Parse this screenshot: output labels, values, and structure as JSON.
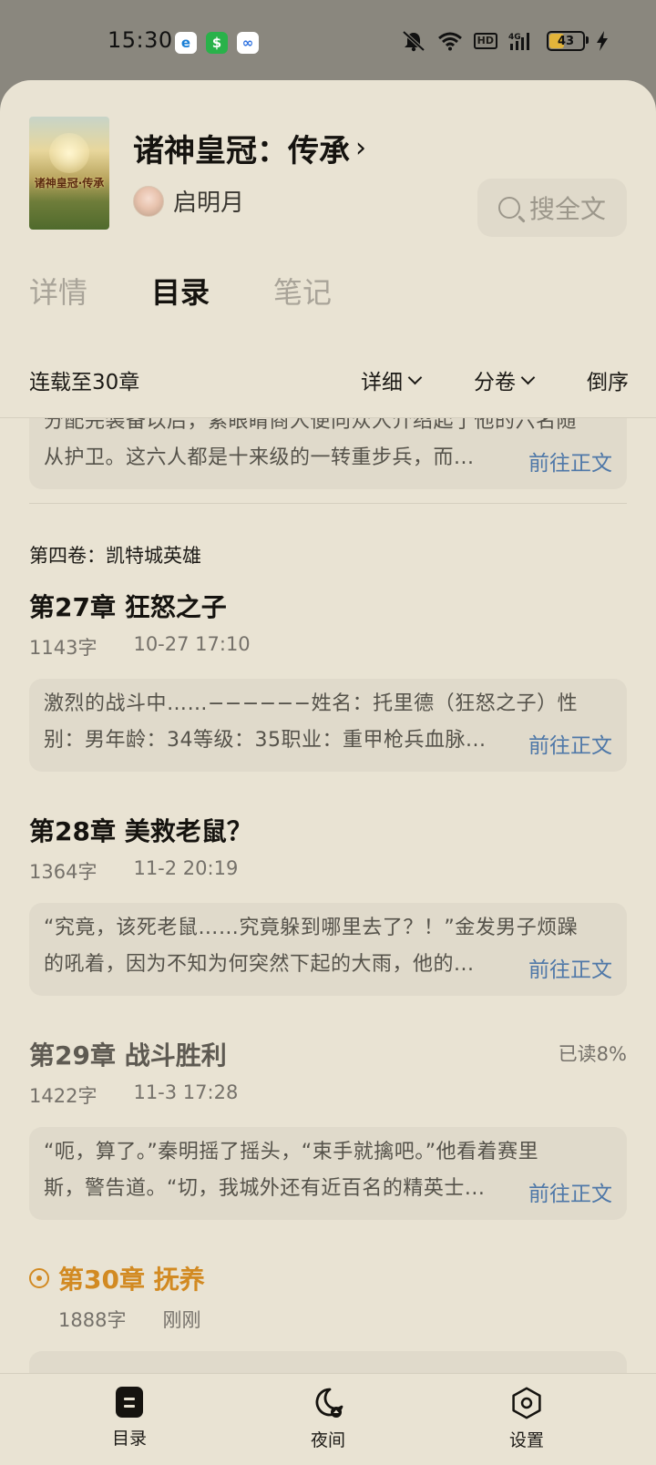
{
  "status_bar": {
    "time": "15:30",
    "battery": "43",
    "battery_fraction": 0.43,
    "app_icons": [
      "telecom-icon",
      "wallet-icon",
      "cloud-icon"
    ]
  },
  "book": {
    "title": "诸神皇冠：传承",
    "author": "启明月",
    "cover_text": "诸神皇冠·传承"
  },
  "search": {
    "label": "搜全文"
  },
  "tabs": [
    {
      "label": "详情",
      "active": false
    },
    {
      "label": "目录",
      "active": true
    },
    {
      "label": "笔记",
      "active": false
    }
  ],
  "filters": {
    "status": "连载至30章",
    "detail": "详细",
    "volume": "分卷",
    "order": "倒序"
  },
  "goto_label": "前往正文",
  "top_summary": {
    "line1": "分配完装备以后，紫眼睛商人便向众人介绍起了他的六名随",
    "line2": "从护卫。这六人都是十来级的一转重步兵，而..."
  },
  "volume_title": "第四卷：凯特城英雄",
  "chapters": [
    {
      "title": "第27章 狂怒之子",
      "words": "1143字",
      "time": "10-27 17:10",
      "line1": "激烈的战斗中……−−−−−−姓名：托里德（狂怒之子）性",
      "line2": "别：男年龄：34等级：35职业：重甲枪兵血脉..."
    },
    {
      "title": "第28章 美救老鼠？",
      "words": "1364字",
      "time": "11-2 20:19",
      "line1": "“究竟，该死老鼠……究竟躲到哪里去了？！”金发男子烦躁",
      "line2": "的吼着，因为不知为何突然下起的大雨，他的..."
    },
    {
      "title": "第29章 战斗胜利",
      "words": "1422字",
      "time": "11-3 17:28",
      "progress": "已读8%",
      "line1": "“呃，算了。”秦明摇了摇头，“束手就擒吧。”他看着赛里",
      "line2": "斯，警告道。“切，我城外还有近百名的精英士..."
    },
    {
      "title": "第30章 抚养",
      "words": "1888字",
      "time": "刚刚"
    }
  ],
  "nav": {
    "toc": "目录",
    "night": "夜间",
    "settings": "设置"
  },
  "colors": {
    "sheet": "#e9e3d3",
    "link": "#4f78a8",
    "current": "#d28a22",
    "card": "#e0dacb"
  }
}
